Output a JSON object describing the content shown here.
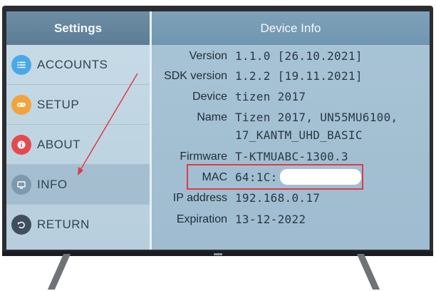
{
  "sidebar": {
    "title": "Settings",
    "items": [
      {
        "label": "ACCOUNTS",
        "icon": "list-icon",
        "color": "#4aa8e8"
      },
      {
        "label": "SETUP",
        "icon": "gamepad-icon",
        "color": "#f2a33a"
      },
      {
        "label": "ABOUT",
        "icon": "info-icon",
        "color": "#e5484d"
      },
      {
        "label": "INFO",
        "icon": "monitor-icon",
        "color": "#7d99ad",
        "selected": true
      },
      {
        "label": "RETURN",
        "icon": "return-icon",
        "color": "#3f4f5c"
      }
    ]
  },
  "panel": {
    "title": "Device Info",
    "rows": [
      {
        "label": "Version",
        "value": "1.1.0 [26.10.2021]"
      },
      {
        "label": "SDK version",
        "value": "1.2.2 [19.11.2021]"
      },
      {
        "label": "Device",
        "value": "tizen 2017"
      },
      {
        "label": "Name",
        "value": "Tizen 2017, UN55MU6100,"
      },
      {
        "label": "",
        "value": "17_KANTM_UHD_BASIC"
      },
      {
        "label": "Firmware",
        "value": "T-KTMUABC-1300.3"
      },
      {
        "label": "MAC",
        "value": "64:1C:"
      },
      {
        "label": "IP address",
        "value": "192.168.0.17"
      },
      {
        "label": "Expiration",
        "value": "13-12-2022"
      }
    ]
  },
  "colors": {
    "highlight_box": "#e03a48",
    "arrow": "#e03a48"
  }
}
